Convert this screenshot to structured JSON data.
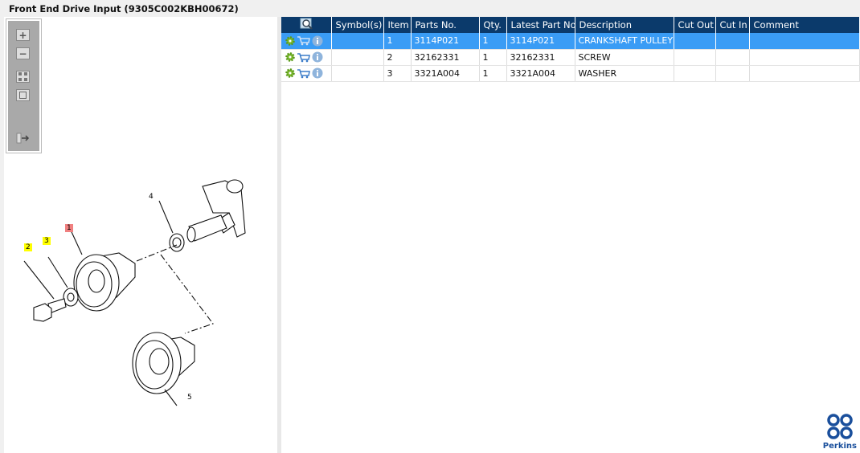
{
  "title": "Front End Drive Input (9305C002KBH00672)",
  "toolbar": {
    "zoom_in": "+",
    "zoom_out": "−"
  },
  "callouts": [
    {
      "label": "1",
      "highlight": "#f08080"
    },
    {
      "label": "2",
      "highlight": "#ffff00"
    },
    {
      "label": "3",
      "highlight": "#ffff00"
    },
    {
      "label": "4",
      "highlight": ""
    },
    {
      "label": "5",
      "highlight": ""
    }
  ],
  "table": {
    "headers": [
      "Symbol(s)",
      "Item",
      "Parts No.",
      "Qty.",
      "Latest Part No.",
      "Description",
      "Cut Out",
      "Cut In",
      "Comment"
    ],
    "rows": [
      {
        "symbol": "",
        "item": "1",
        "parts_no": "3114P021",
        "qty": "1",
        "latest": "3114P021",
        "description": "CRANKSHAFT PULLEY",
        "cut_out": "",
        "cut_in": "",
        "comment": "",
        "selected": true
      },
      {
        "symbol": "",
        "item": "2",
        "parts_no": "32162331",
        "qty": "1",
        "latest": "32162331",
        "description": "SCREW",
        "cut_out": "",
        "cut_in": "",
        "comment": "",
        "selected": false
      },
      {
        "symbol": "",
        "item": "3",
        "parts_no": "3321A004",
        "qty": "1",
        "latest": "3321A004",
        "description": "WASHER",
        "cut_out": "",
        "cut_in": "",
        "comment": "",
        "selected": false
      }
    ]
  },
  "brand": {
    "name": "Perkins",
    "color": "#1a4f9c"
  },
  "colors": {
    "header": "#0b3a6b",
    "selected": "#3a9cf5"
  }
}
